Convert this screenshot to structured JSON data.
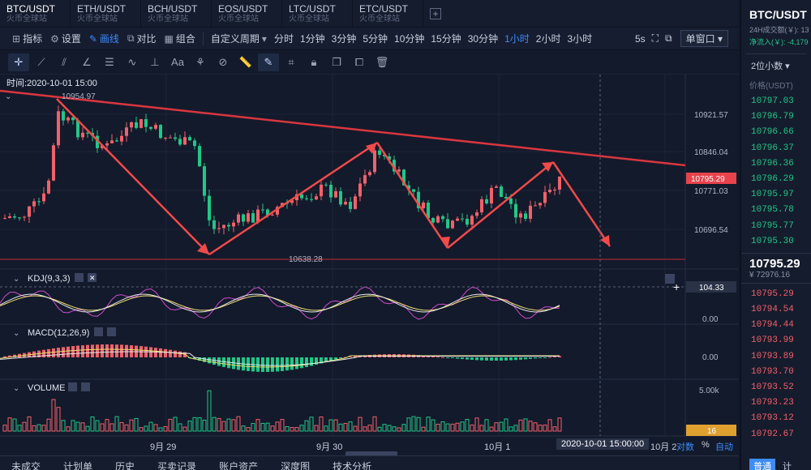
{
  "tabs": [
    {
      "pair": "BTC/USDT",
      "exchange": "火币全球站"
    },
    {
      "pair": "ETH/USDT",
      "exchange": "火币全球站"
    },
    {
      "pair": "BCH/USDT",
      "exchange": "火币全球站"
    },
    {
      "pair": "EOS/USDT",
      "exchange": "火币全球站"
    },
    {
      "pair": "LTC/USDT",
      "exchange": "火币全球站"
    },
    {
      "pair": "ETC/USDT",
      "exchange": "火币全球站"
    }
  ],
  "tab_add": "+",
  "toolbar": {
    "indicators": "指标",
    "settings": "设置",
    "draw": "画线",
    "compare": "对比",
    "combine": "组合",
    "custom_period": "自定义周期",
    "periods": [
      "分时",
      "1分钟",
      "3分钟",
      "5分钟",
      "10分钟",
      "15分钟",
      "30分钟",
      "1小时",
      "2小时",
      "3小时"
    ],
    "active_period": "1小时",
    "refresh": "5s",
    "window_mode": "单窗口"
  },
  "chart": {
    "time_label": "时间:2020-10-01 15:00",
    "price_axis": [
      "10921.57",
      "10846.04",
      "10771.03",
      "10696.54"
    ],
    "current_price": "10795.29",
    "high_label": "10954.97",
    "low_label": "10638.28",
    "kdj_label": "KDJ(9,3,3)",
    "kdj_axis": [
      "104.33",
      "0.00"
    ],
    "macd_label": "MACD(12,26,9)",
    "macd_axis": [
      "0.00"
    ],
    "volume_label": "VOLUME",
    "volume_axis": [
      "5.00k"
    ],
    "volume_current": "16",
    "x_labels": [
      "9月 29",
      "9月 30",
      "10月 1",
      "10月 2"
    ],
    "crosshair_time": "2020-10-01 15:00:00",
    "corner_buttons": [
      "对数",
      "%",
      "自动"
    ]
  },
  "bottom_tabs": [
    "未成交",
    "计划单",
    "历史",
    "买卖记录",
    "账户资产",
    "深度图",
    "技术分析"
  ],
  "side": {
    "pair": "BTC/USDT",
    "volume_label": "24H成交额(￥): 13",
    "inflow_label": "净流入(￥): -4,179",
    "decimals": "2位小数",
    "price_header": "价格(USDT)",
    "asks": [
      "10797.03",
      "10796.79",
      "10796.66",
      "10796.37",
      "10796.36",
      "10796.29",
      "10795.97",
      "10795.78",
      "10795.77",
      "10795.30"
    ],
    "last_price": "10795.29",
    "last_cny": "¥ 72976.16",
    "bids": [
      "10795.29",
      "10794.54",
      "10794.44",
      "10793.99",
      "10793.89",
      "10793.70",
      "10793.52",
      "10793.23",
      "10793.12",
      "10792.67"
    ],
    "bottom_btns": [
      "普通",
      "计"
    ]
  },
  "colors": {
    "up": "#f0616a",
    "down": "#1fc789",
    "trend": "#d9363e",
    "accent": "#3d8bfd"
  }
}
